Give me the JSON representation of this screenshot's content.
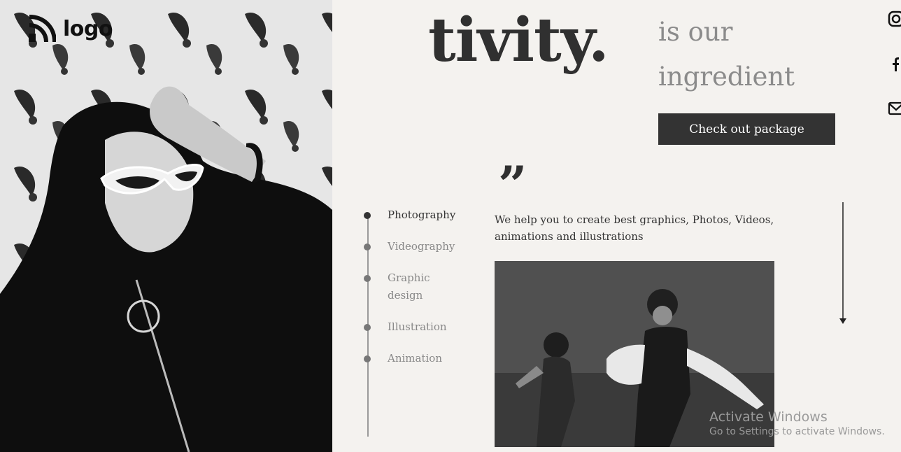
{
  "brand": {
    "logo_text": "logo"
  },
  "hero": {
    "headline": "tivity.",
    "subline": "is our ingredient"
  },
  "cta": {
    "label": "Check out package"
  },
  "services": {
    "items": [
      {
        "label": "Photography",
        "active": true
      },
      {
        "label": "Videography",
        "active": false
      },
      {
        "label": "Graphic design",
        "active": false
      },
      {
        "label": "Illustration",
        "active": false
      },
      {
        "label": "Animation",
        "active": false
      }
    ]
  },
  "quote": {
    "mark": "”",
    "text": "We help you to create best graphics, Photos, Videos, animations and illustrations"
  },
  "social": {
    "icons": [
      "instagram-icon",
      "facebook-icon",
      "mail-icon"
    ]
  },
  "watermark": {
    "title": "Activate Windows",
    "subtitle": "Go to Settings to activate Windows."
  },
  "colors": {
    "background": "#f4f2ef",
    "dark": "#333333",
    "muted": "#8b8b8b"
  }
}
